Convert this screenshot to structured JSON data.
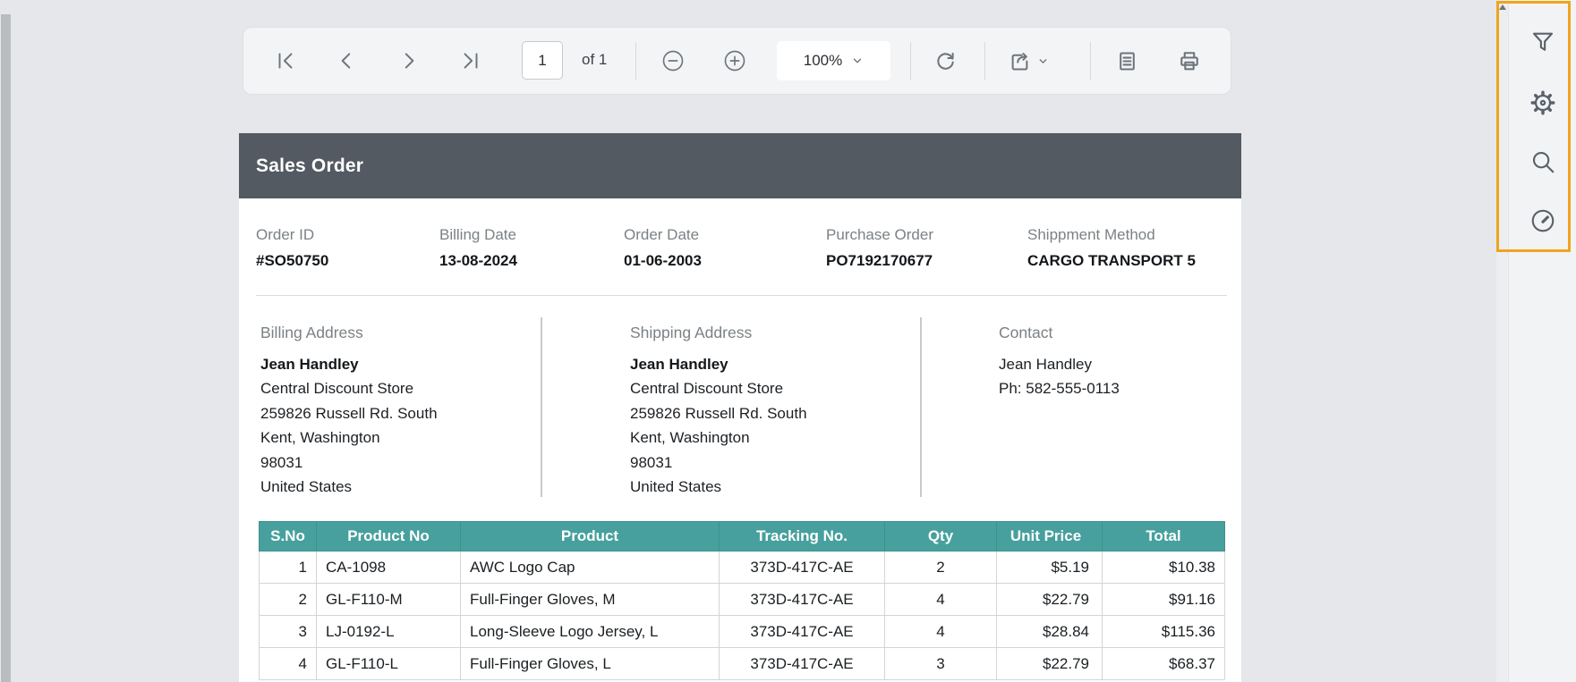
{
  "toolbar": {
    "page_input": "1",
    "page_count_label": "of 1",
    "zoom_value": "100%",
    "icons": [
      "first-page",
      "previous-page",
      "next-page",
      "last-page",
      "zoom-out",
      "zoom-in",
      "refresh",
      "export",
      "print-layout",
      "print"
    ]
  },
  "sidebar": {
    "icons": [
      "filter",
      "settings",
      "search",
      "performance-gauge"
    ]
  },
  "report": {
    "title": "Sales Order",
    "fields": [
      {
        "label": "Order ID",
        "value": "#SO50750"
      },
      {
        "label": "Billing Date",
        "value": "13-08-2024"
      },
      {
        "label": "Order Date",
        "value": "01-06-2003"
      },
      {
        "label": "Purchase Order",
        "value": "PO7192170677"
      },
      {
        "label": "Shippment Method",
        "value": "CARGO TRANSPORT 5"
      }
    ],
    "billing": {
      "label": "Billing Address",
      "name": "Jean Handley",
      "lines": [
        "Central Discount Store",
        "259826 Russell Rd. South",
        "Kent, Washington",
        "98031",
        "United States"
      ]
    },
    "shipping": {
      "label": "Shipping Address",
      "name": "Jean Handley",
      "lines": [
        "Central Discount Store",
        "259826 Russell Rd. South",
        "Kent, Washington",
        "98031",
        "United States"
      ]
    },
    "contact": {
      "label": "Contact",
      "lines": [
        "Jean Handley",
        "Ph: 582-555-0113"
      ]
    },
    "table": {
      "headers": [
        "S.No",
        "Product No",
        "Product",
        "Tracking No.",
        "Qty",
        "Unit Price",
        "Total"
      ],
      "rows": [
        [
          "1",
          "CA-1098",
          "AWC Logo Cap",
          "373D-417C-AE",
          "2",
          "$5.19",
          "$10.38"
        ],
        [
          "2",
          "GL-F110-M",
          "Full-Finger Gloves, M",
          "373D-417C-AE",
          "4",
          "$22.79",
          "$91.16"
        ],
        [
          "3",
          "LJ-0192-L",
          "Long-Sleeve Logo Jersey, L",
          "373D-417C-AE",
          "4",
          "$28.84",
          "$115.36"
        ],
        [
          "4",
          "GL-F110-L",
          "Full-Finger Gloves, L",
          "373D-417C-AE",
          "3",
          "$22.79",
          "$68.37"
        ]
      ]
    }
  },
  "colors": {
    "accent_teal": "#47a09d",
    "header_dark": "#545a62",
    "highlight_orange": "#f0a41c",
    "background": "#e5e7ea",
    "toolbar_bg": "#f3f4f6"
  }
}
